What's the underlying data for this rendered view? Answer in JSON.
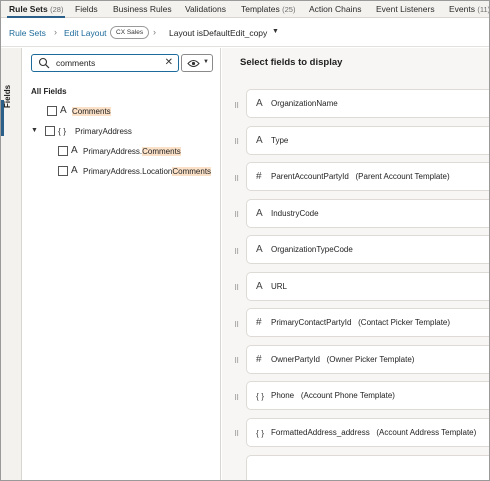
{
  "tabs": [
    {
      "label": "Rule Sets",
      "count": "(28)",
      "active": true
    },
    {
      "label": "Fields",
      "count": ""
    },
    {
      "label": "Business Rules",
      "count": ""
    },
    {
      "label": "Validations",
      "count": ""
    },
    {
      "label": "Templates",
      "count": "(25)"
    },
    {
      "label": "Action Chains",
      "count": ""
    },
    {
      "label": "Event Listeners",
      "count": ""
    },
    {
      "label": "Events",
      "count": "(11)"
    }
  ],
  "breadcrumb": {
    "rule_sets": "Rule Sets",
    "edit_layout": "Edit Layout",
    "badge": "CX Sales",
    "current": "Layout isDefaultEdit_copy"
  },
  "side_tab": {
    "label": "Fields"
  },
  "search": {
    "value": "comments"
  },
  "tree": {
    "heading": "All Fields",
    "items": [
      {
        "icon": "text-type-icon",
        "label_pre": "",
        "label_hl": "Comments",
        "label_post": ""
      },
      {
        "icon": "object-type-icon",
        "label": "PrimaryAddress",
        "expanded": true
      },
      {
        "icon": "text-type-icon",
        "label_pre": "PrimaryAddress.",
        "label_hl": "Comments",
        "label_post": ""
      },
      {
        "icon": "text-type-icon",
        "label_pre": "PrimaryAddress.Location",
        "label_hl": "Comments",
        "label_post": ""
      }
    ]
  },
  "panel": {
    "title": "Select fields to display",
    "fields": [
      {
        "type": "text-type-icon",
        "glyph": "A",
        "name": "OrganizationName",
        "template": ""
      },
      {
        "type": "text-type-icon",
        "glyph": "A",
        "name": "Type",
        "template": ""
      },
      {
        "type": "number-type-icon",
        "glyph": "#",
        "name": "ParentAccountPartyId",
        "template": "(Parent Account Template)"
      },
      {
        "type": "text-type-icon",
        "glyph": "A",
        "name": "IndustryCode",
        "template": ""
      },
      {
        "type": "text-type-icon",
        "glyph": "A",
        "name": "OrganizationTypeCode",
        "template": ""
      },
      {
        "type": "text-type-icon",
        "glyph": "A",
        "name": "URL",
        "template": ""
      },
      {
        "type": "number-type-icon",
        "glyph": "#",
        "name": "PrimaryContactPartyId",
        "template": "(Contact Picker Template)"
      },
      {
        "type": "number-type-icon",
        "glyph": "#",
        "name": "OwnerPartyId",
        "template": "(Owner Picker Template)"
      },
      {
        "type": "object-type-icon",
        "glyph": "{ }",
        "name": "Phone",
        "template": "(Account Phone Template)"
      },
      {
        "type": "object-type-icon",
        "glyph": "{ }",
        "name": "FormattedAddress_address",
        "template": "(Account Address Template)"
      }
    ]
  },
  "colors": {
    "accent": "#2a5f8a",
    "link": "#1d6b9a",
    "highlight": "#fbe1c8"
  }
}
